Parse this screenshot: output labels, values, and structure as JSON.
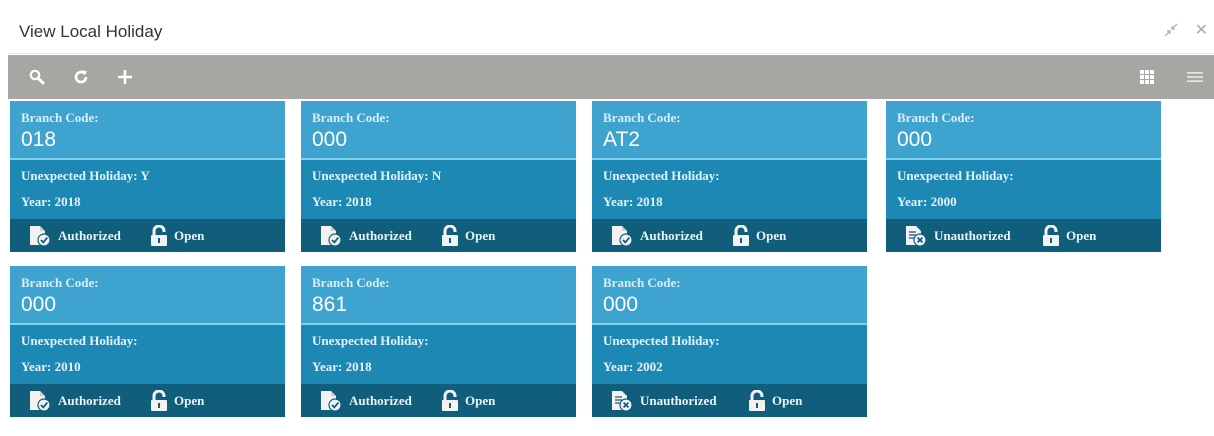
{
  "window": {
    "title": "View Local Holiday",
    "minimize_icon": "collapse-arrows-icon",
    "close_label": "✕"
  },
  "toolbar": {
    "left_icons": [
      "search-icon",
      "refresh-icon",
      "add-icon"
    ],
    "right_icons": [
      "grid-view-icon",
      "list-view-icon"
    ]
  },
  "labels": {
    "branch_code": "Branch Code:",
    "unexpected_holiday": "Unexpected Holiday:",
    "year": "Year:"
  },
  "colors": {
    "card_top": "#3ea3cf",
    "card_mid": "#1d88b4",
    "card_bottom": "#115d7c",
    "toolbar": "#a8a6a3"
  },
  "cards": [
    {
      "branch_code": "018",
      "unexpected_holiday": "Y",
      "year": "2018",
      "auth_status": "Authorized",
      "record_status": "Open"
    },
    {
      "branch_code": "000",
      "unexpected_holiday": "N",
      "year": "2018",
      "auth_status": "Authorized",
      "record_status": "Open"
    },
    {
      "branch_code": "AT2",
      "unexpected_holiday": "",
      "year": "2018",
      "auth_status": "Authorized",
      "record_status": "Open"
    },
    {
      "branch_code": "000",
      "unexpected_holiday": "",
      "year": "2000",
      "auth_status": "Unauthorized",
      "record_status": "Open"
    },
    {
      "branch_code": "000",
      "unexpected_holiday": "",
      "year": "2010",
      "auth_status": "Authorized",
      "record_status": "Open"
    },
    {
      "branch_code": "861",
      "unexpected_holiday": "",
      "year": "2018",
      "auth_status": "Authorized",
      "record_status": "Open"
    },
    {
      "branch_code": "000",
      "unexpected_holiday": "",
      "year": "2002",
      "auth_status": "Unauthorized",
      "record_status": "Open"
    }
  ]
}
